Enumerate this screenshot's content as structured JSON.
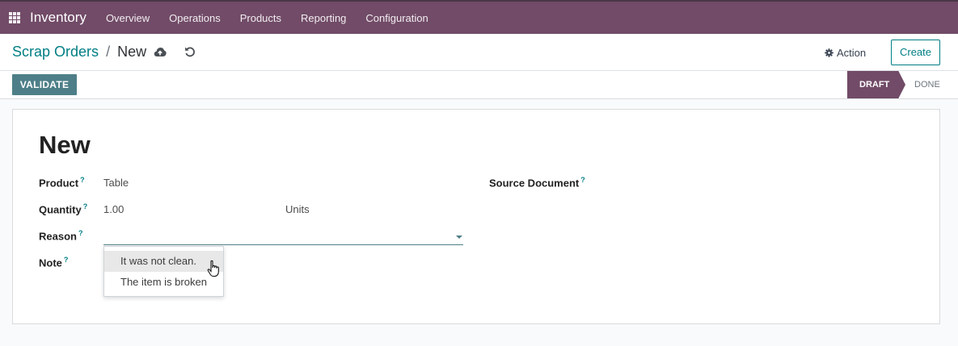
{
  "topnav": {
    "app_name": "Inventory",
    "menu": [
      "Overview",
      "Operations",
      "Products",
      "Reporting",
      "Configuration"
    ]
  },
  "breadcrumb": {
    "parent": "Scrap Orders",
    "separator": "/",
    "current": "New"
  },
  "toolbar": {
    "action_label": "Action",
    "create_label": "Create"
  },
  "statusbar": {
    "validate_label": "VALIDATE",
    "stages": [
      "DRAFT",
      "DONE"
    ],
    "active_stage": "DRAFT"
  },
  "form": {
    "title": "New",
    "fields": {
      "product": {
        "label": "Product",
        "help": "?",
        "value": "Table"
      },
      "quantity": {
        "label": "Quantity",
        "help": "?",
        "value": "1.00",
        "uom": "Units"
      },
      "reason": {
        "label": "Reason",
        "help": "?",
        "value": ""
      },
      "note": {
        "label": "Note",
        "help": "?"
      },
      "source_document": {
        "label": "Source Document",
        "help": "?"
      }
    }
  },
  "reason_dropdown": {
    "options": [
      "It was not clean.",
      "The item is broken"
    ],
    "highlighted": "It was not clean."
  },
  "colors": {
    "brand": "#714b67",
    "accent": "#017e84",
    "validate": "#4e7f88"
  },
  "icons": [
    "apps-grid-icon",
    "cloud-upload-icon",
    "undo-icon",
    "gear-icon",
    "caret-down-icon",
    "hand-pointer-icon"
  ]
}
